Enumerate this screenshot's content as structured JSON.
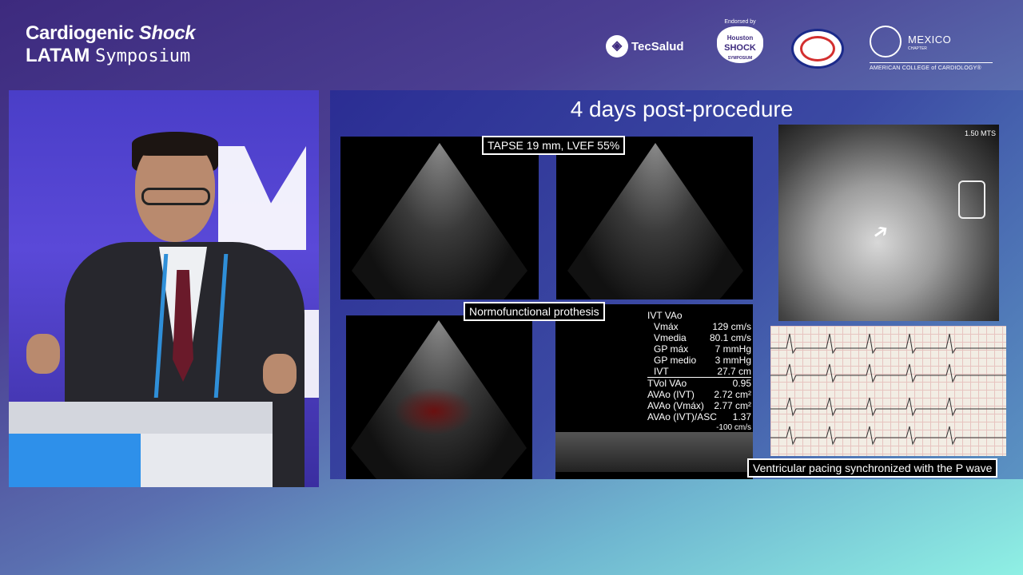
{
  "brand": {
    "line1_a": "Cardiogenic",
    "line1_b": "Shock",
    "line2_a": "LATAM",
    "line2_b": "Symposium"
  },
  "logos": {
    "tecsalud": "TecSalud",
    "houston_endorsed": "Endorsed by",
    "houston_top": "Houston",
    "houston_main": "SHOCK",
    "houston_sub": "SYMPOSIUM",
    "acc_country": "MEXICO",
    "acc_chapter": "CHAPTER",
    "acc_name": "AMERICAN COLLEGE of CARDIOLOGY®"
  },
  "slide": {
    "title": "4 days post-procedure",
    "label_tapse": "TAPSE 19 mm, LVEF 55%",
    "label_prosthesis": "Normofunctional prothesis",
    "label_pacing": "Ventricular pacing synchronized with the P wave",
    "xray_marker": "1.50 MTS",
    "doppler_table": {
      "header": "IVT VAo",
      "rows": [
        {
          "k": "Vmáx",
          "v": "129 cm/s"
        },
        {
          "k": "Vmedia",
          "v": "80.1 cm/s"
        },
        {
          "k": "GP máx",
          "v": "7 mmHg"
        },
        {
          "k": "GP medio",
          "v": "3 mmHg"
        },
        {
          "k": "IVT",
          "v": "27.7 cm"
        },
        {
          "k": "TVol VAo",
          "v": "0.95"
        },
        {
          "k": "AVAo (IVT)",
          "v": "2.72 cm²"
        },
        {
          "k": "AVAo (Vmáx)",
          "v": "2.77 cm²"
        },
        {
          "k": "AVAo (IVT)/ASC",
          "v": "1.37"
        }
      ],
      "scale": "-100",
      "scale_unit": "cm/s"
    }
  },
  "colors": {
    "accent_blue": "#2e90ea",
    "slide_bg": "#2b2d93",
    "label_bg": "#000000"
  }
}
